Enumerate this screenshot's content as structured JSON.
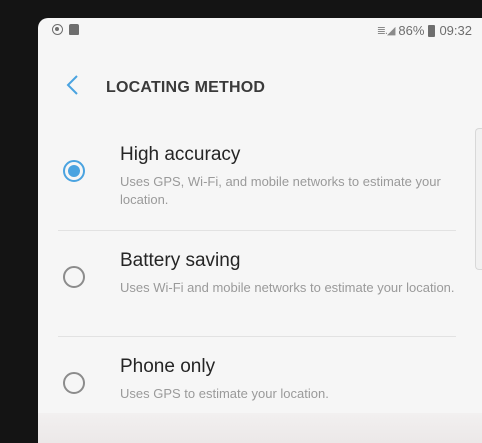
{
  "status_bar": {
    "left_icons": [
      "record-icon",
      "shopping-bag-icon"
    ],
    "signal": "≣.◢",
    "battery": "86%",
    "time": "09:32"
  },
  "header": {
    "back_icon": "chevron-left-icon",
    "title": "LOCATING METHOD"
  },
  "options": [
    {
      "title": "High accuracy",
      "description": "Uses GPS, Wi-Fi, and mobile networks to estimate your location.",
      "selected": true
    },
    {
      "title": "Battery saving",
      "description": "Uses Wi-Fi and mobile networks to estimate your location.",
      "selected": false
    },
    {
      "title": "Phone only",
      "description": "Uses GPS to estimate your location.",
      "selected": false
    }
  ],
  "colors": {
    "accent": "#4aa3e0",
    "background": "#f6f6f6",
    "text_primary": "#252525",
    "text_secondary": "#9a9a9a"
  }
}
